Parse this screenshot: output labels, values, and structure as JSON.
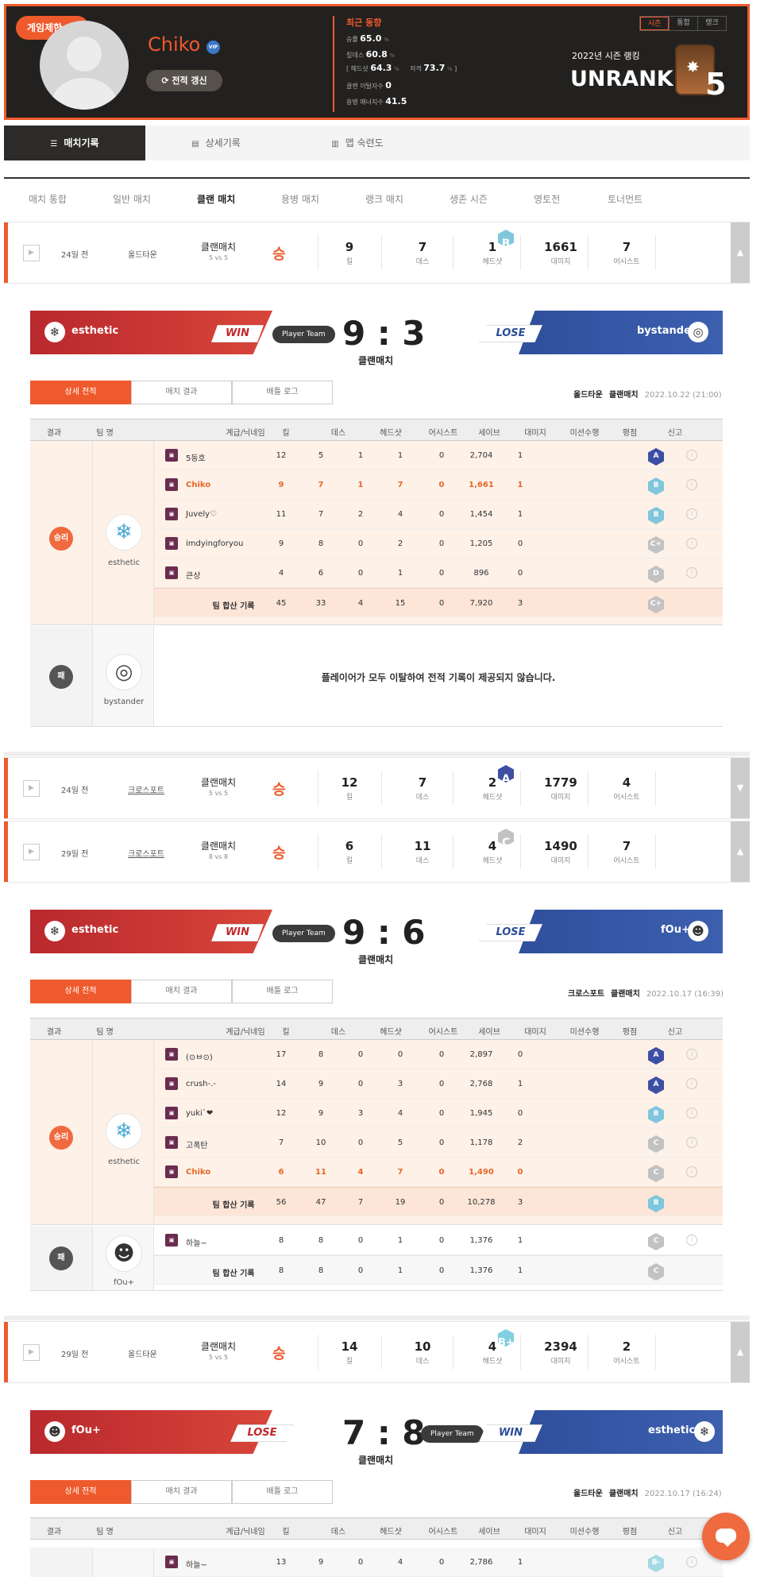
{
  "header": {
    "restriction": "게임제한",
    "name": "Chiko",
    "vip": "VIP",
    "refresh": "전적 갱신",
    "recent_title": "최근 동향",
    "winrate_label": "승률",
    "winrate": "65.0",
    "kd_label": "킬데스",
    "kd": "60.8",
    "hs_label": "헤드샷",
    "hs": "64.3",
    "snipe_label": "저격",
    "snipe": "73.7",
    "pct": "%",
    "clan_leave_label": "클랜 이탈자수",
    "clan_leave": "0",
    "merc_manner_label": "용병 매너지수",
    "merc_manner": "41.5",
    "season_tabs": [
      "시즌",
      "통합",
      "랭크"
    ],
    "season_label": "2022년 시즌 랭킹",
    "rank_text": "UNRANK",
    "rank_no": "5"
  },
  "top_tabs": [
    "매치기록",
    "상세기록",
    "맵 숙련도"
  ],
  "sub_nav": [
    "매치 통합",
    "일반 매치",
    "클랜 매치",
    "용병 매치",
    "랭크 매치",
    "생존 시즌",
    "영토전",
    "토너먼트"
  ],
  "stat_labels": [
    "킬",
    "데스",
    "헤드샷",
    "대미지",
    "어시스트"
  ],
  "detail_tabs": [
    "상세 전적",
    "매치 결과",
    "배틀 로그"
  ],
  "table_headers": [
    "결과",
    "팀 명",
    "계급/닉네임",
    "킬",
    "데스",
    "헤드샷",
    "어시스트",
    "세이브",
    "대미지",
    "미션수행",
    "평점",
    "신고"
  ],
  "no_record_msg": "플레이어가 모두 이탈하여 전적 기록이 제공되지 않습니다.",
  "total_label": "팀 합산 기록",
  "win_label": "승리",
  "lose_label": "패",
  "player_team": "Player Team",
  "match_type": "클랜매치",
  "matches": [
    {
      "ago": "24일 전",
      "map": "올드타운",
      "type": "클랜매치",
      "mode": "5 vs 5",
      "result": "승",
      "kill": "9",
      "death": "7",
      "hs": "1",
      "damage": "1661",
      "assist": "7",
      "grade": "B"
    },
    {
      "ago": "24일 전",
      "map": "크로스포트",
      "type": "클랜매치",
      "mode": "5 vs 5",
      "result": "승",
      "kill": "12",
      "death": "7",
      "hs": "2",
      "damage": "1779",
      "assist": "4",
      "grade": "A"
    },
    {
      "ago": "29일 전",
      "map": "크로스포트",
      "type": "클랜매치",
      "mode": "8 vs 8",
      "result": "승",
      "kill": "6",
      "death": "11",
      "hs": "4",
      "damage": "1490",
      "assist": "7",
      "grade": "C"
    },
    {
      "ago": "29일 전",
      "map": "올드타운",
      "type": "클랜매치",
      "mode": "5 vs 5",
      "result": "승",
      "kill": "14",
      "death": "10",
      "hs": "4",
      "damage": "2394",
      "assist": "2",
      "grade": "B+"
    }
  ],
  "detail1": {
    "left": "esthetic",
    "right": "bystander",
    "lefttag": "WIN",
    "righttag": "LOSE",
    "score": "9 : 3",
    "map": "올드타운",
    "mtype": "클랜매치",
    "date": "2022.10.22 (21:00)",
    "players": [
      [
        "5동호",
        "12",
        "5",
        "1",
        "1",
        "0",
        "2,704",
        "1",
        "A"
      ],
      [
        "Chiko",
        "9",
        "7",
        "1",
        "7",
        "0",
        "1,661",
        "1",
        "B"
      ],
      [
        "Juvely♡",
        "11",
        "7",
        "2",
        "4",
        "0",
        "1,454",
        "1",
        "B"
      ],
      [
        "imdyingforyou",
        "9",
        "8",
        "0",
        "2",
        "0",
        "1,205",
        "0",
        "C+"
      ],
      [
        "큰상",
        "4",
        "6",
        "0",
        "1",
        "0",
        "896",
        "0",
        "D"
      ]
    ],
    "total": [
      "45",
      "33",
      "4",
      "15",
      "0",
      "7,920",
      "3",
      "C+"
    ]
  },
  "detail2": {
    "left": "esthetic",
    "right": "fOu+",
    "lefttag": "WIN",
    "righttag": "LOSE",
    "score": "9 : 6",
    "map": "크로스포트",
    "mtype": "클랜매치",
    "date": "2022.10.17 (16:39)",
    "players": [
      [
        "(⊙ㅂ⊙)",
        "17",
        "8",
        "0",
        "0",
        "0",
        "2,897",
        "0",
        "A"
      ],
      [
        "crush-.-",
        "14",
        "9",
        "0",
        "3",
        "0",
        "2,768",
        "1",
        "A"
      ],
      [
        "yuki`❤",
        "12",
        "9",
        "3",
        "4",
        "0",
        "1,945",
        "0",
        "B"
      ],
      [
        "고폭탄",
        "7",
        "10",
        "0",
        "5",
        "0",
        "1,178",
        "2",
        "C"
      ],
      [
        "Chiko",
        "6",
        "11",
        "4",
        "7",
        "0",
        "1,490",
        "0",
        "C"
      ]
    ],
    "total": [
      "56",
      "47",
      "7",
      "19",
      "0",
      "10,278",
      "3",
      "B"
    ],
    "lose_players": [
      [
        "하늘~",
        "8",
        "8",
        "0",
        "1",
        "0",
        "1,376",
        "1",
        "C"
      ]
    ],
    "lose_total": [
      "8",
      "8",
      "0",
      "1",
      "0",
      "1,376",
      "1",
      "C"
    ]
  },
  "detail3": {
    "left": "fOu+",
    "right": "esthetic",
    "lefttag": "LOSE",
    "righttag": "WIN",
    "score": "7 : 8",
    "map": "올드타운",
    "mtype": "클랜매치",
    "date": "2022.10.17 (16:24)",
    "players": [
      [
        "하늘~",
        "13",
        "9",
        "0",
        "4",
        "0",
        "2,786",
        "1",
        "B-"
      ]
    ]
  },
  "colors": {
    "accent": "#ef5a2c",
    "win_red": "#c3282c",
    "lose_blue": "#2d4d99"
  }
}
